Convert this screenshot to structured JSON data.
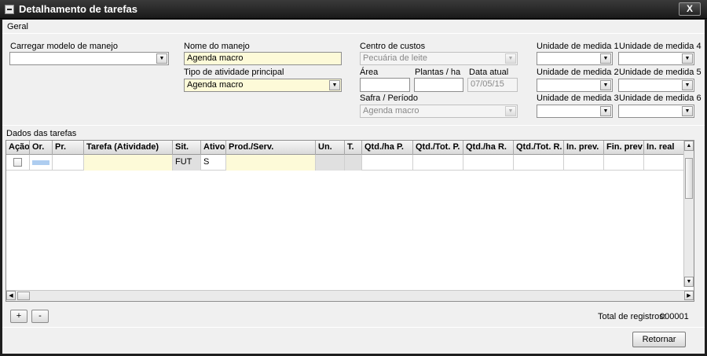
{
  "window": {
    "title": "Detalhamento de tarefas",
    "close_label": "X"
  },
  "geral": {
    "section_label": "Geral",
    "carregar_modelo": {
      "label": "Carregar modelo de manejo",
      "value": ""
    },
    "nome_manejo": {
      "label": "Nome do manejo",
      "value": "Agenda macro"
    },
    "tipo_atividade": {
      "label": "Tipo de atividade principal",
      "value": "Agenda macro"
    },
    "centro_custos": {
      "label": "Centro de custos",
      "value": "Pecuária de leite"
    },
    "area": {
      "label": "Área",
      "value": ""
    },
    "plantas_ha": {
      "label": "Plantas / ha",
      "value": ""
    },
    "data_atual": {
      "label": "Data atual",
      "value": "07/05/15"
    },
    "safra_periodo": {
      "label": "Safra / Período",
      "value": "Agenda macro"
    },
    "unidades": [
      {
        "label": "Unidade de medida 1",
        "value": ""
      },
      {
        "label": "Unidade de medida 4",
        "value": ""
      },
      {
        "label": "Unidade de medida 2",
        "value": ""
      },
      {
        "label": "Unidade de medida 5",
        "value": ""
      },
      {
        "label": "Unidade de medida 3",
        "value": ""
      },
      {
        "label": "Unidade de medida 6",
        "value": ""
      }
    ]
  },
  "tarefas": {
    "section_label": "Dados das tarefas",
    "columns": [
      "Ação",
      "Or.",
      "Pr.",
      "Tarefa (Atividade)",
      "Sit.",
      "Ativo",
      "Prod./Serv.",
      "Un.",
      "T.",
      "Qtd./ha P.",
      "Qtd./Tot. P.",
      "Qtd./ha  R.",
      "Qtd./Tot. R.",
      "In. prev.",
      "Fin. prev",
      "In. real"
    ],
    "rows": [
      {
        "sit": "FUT",
        "ativo": "S",
        "acao_checked": false
      }
    ],
    "add_label": "+",
    "remove_label": "-",
    "total_label": "Total de registros:",
    "total_value": "000001"
  },
  "footer": {
    "retornar_label": "Retornar"
  },
  "icons": {
    "dropdown": "chevron-down-icon",
    "scroll_up": "arrow-up-icon",
    "scroll_down": "arrow-down-icon",
    "scroll_left": "arrow-left-icon",
    "scroll_right": "arrow-right-icon"
  }
}
